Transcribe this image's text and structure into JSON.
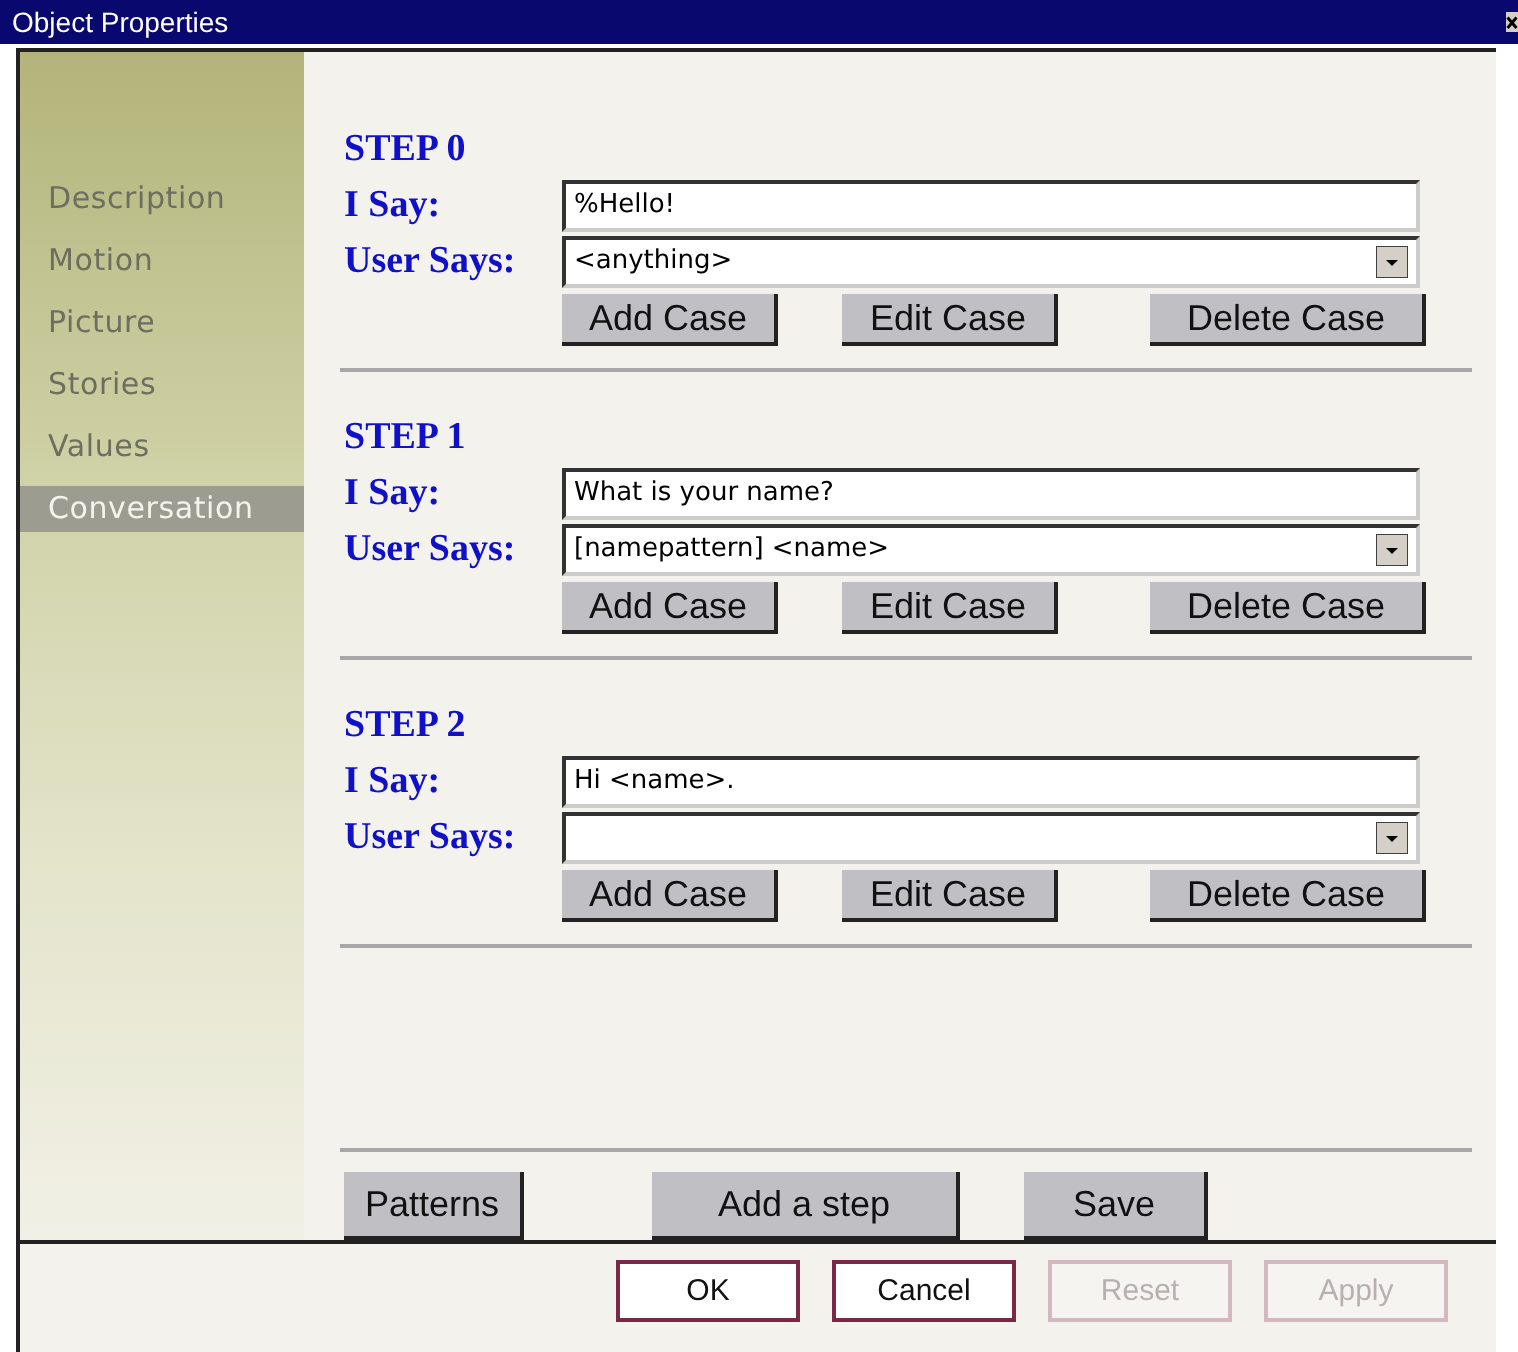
{
  "window": {
    "title": "Object Properties"
  },
  "sidebar": {
    "items": [
      {
        "label": "Description",
        "selected": false
      },
      {
        "label": "Motion",
        "selected": false
      },
      {
        "label": "Picture",
        "selected": false
      },
      {
        "label": "Stories",
        "selected": false
      },
      {
        "label": "Values",
        "selected": false
      },
      {
        "label": "Conversation",
        "selected": true
      }
    ]
  },
  "steps": [
    {
      "title": "STEP 0",
      "i_say_label": "I Say:",
      "i_say": "%Hello!",
      "user_says_label": "User Says:",
      "user_says": "<anything>",
      "buttons": [
        "Add Case",
        "Edit Case",
        "Delete Case"
      ]
    },
    {
      "title": "STEP 1",
      "i_say_label": "I Say:",
      "i_say": "What is your name?",
      "user_says_label": "User Says:",
      "user_says": "[namepattern] <name>",
      "buttons": [
        "Add Case",
        "Edit Case",
        "Delete Case"
      ]
    },
    {
      "title": "STEP 2",
      "i_say_label": "I Say:",
      "i_say": "Hi <name>.",
      "user_says_label": "User Says:",
      "buttons": [
        "Add Case",
        "Edit Case",
        "Delete Case"
      ]
    }
  ],
  "actions": [
    "Patterns",
    "Add a step",
    "Save"
  ],
  "footer_buttons": [
    {
      "label": "OK",
      "disabled": false
    },
    {
      "label": "Cancel",
      "disabled": false
    },
    {
      "label": "Reset",
      "disabled": true
    },
    {
      "label": "Apply",
      "disabled": true
    }
  ]
}
